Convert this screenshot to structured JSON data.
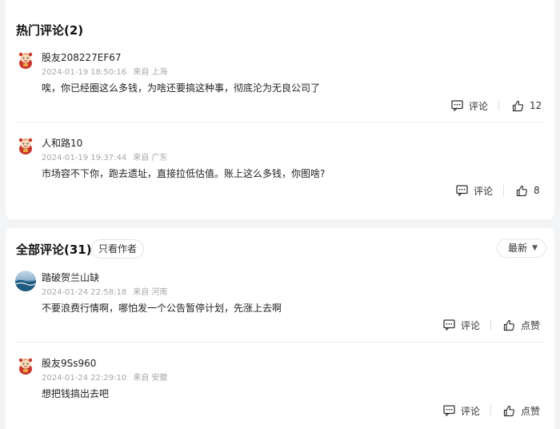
{
  "hot": {
    "title": "热门评论(2)",
    "comments": [
      {
        "author": "股友208227EF67",
        "time": "2024-01-19 18:50:16",
        "location": "来自 上海",
        "text": "唉，你已经圈这么多钱，为啥还要搞这种事，彻底沦为无良公司了",
        "comment_label": "评论",
        "like_label": "12"
      },
      {
        "author": "人和路10",
        "time": "2024-01-19 19:37:44",
        "location": "来自 广东",
        "text": "市场容不下你，跑去遗址，直接拉低估值。账上这么多钱，你图啥?",
        "comment_label": "评论",
        "like_label": "8"
      }
    ]
  },
  "all": {
    "title": "全部评论(31)",
    "only_author_label": "只看作者",
    "sort_label": "最新",
    "comments": [
      {
        "author": "踏破贺兰山缺",
        "time": "2024-01-24 22:58:18",
        "location": "来自 河南",
        "text": "不要浪费行情啊，哪怕发一个公告暂停计划，先涨上去啊",
        "comment_label": "评论",
        "like_label": "点赞"
      },
      {
        "author": "股友9Ss960",
        "time": "2024-01-24 22:29:10",
        "location": "来自 安徽",
        "text": "想把钱搞出去吧",
        "comment_label": "评论",
        "like_label": "点赞"
      }
    ]
  },
  "icons": {
    "default_avatar": "fortune-mascot-avatar-icon",
    "photo_avatar": "landscape-photo-avatar",
    "comment": "comment-bubble-icon",
    "like": "thumbs-up-icon",
    "sort": "chevron-down-icon"
  },
  "colors": {
    "page_bg": "#f3f4f6",
    "card_bg": "#ffffff",
    "meta_text": "#a7a7a7",
    "mascot_red": "#c9372c",
    "mascot_gold": "#e9a642"
  }
}
